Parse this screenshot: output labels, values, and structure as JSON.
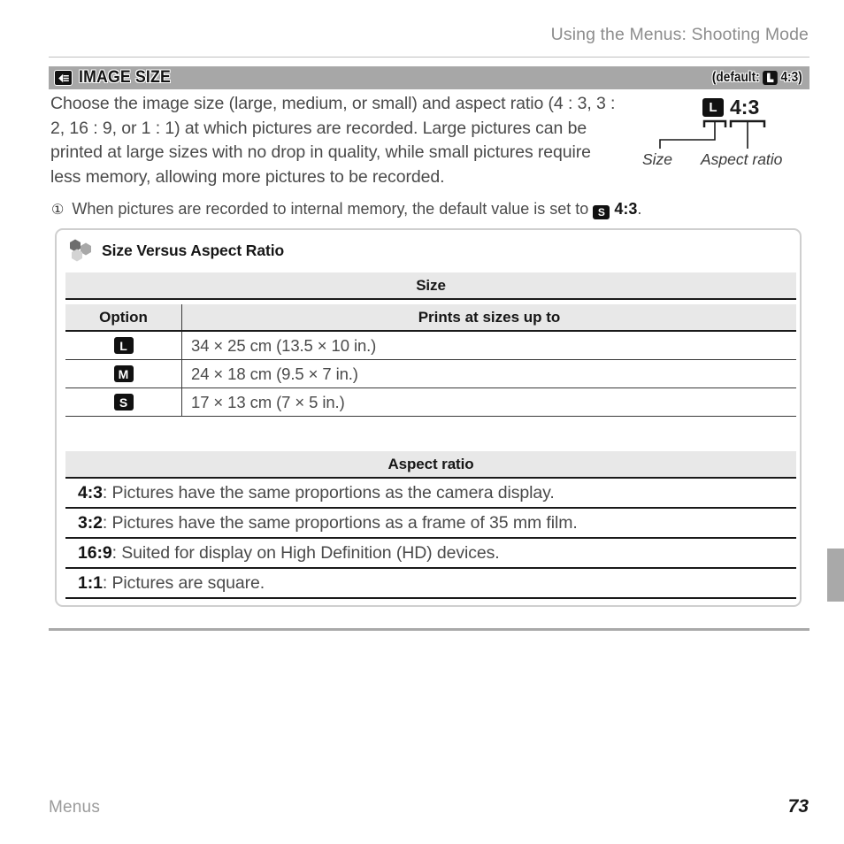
{
  "running_head": "Using the Menus: Shooting Mode",
  "section": {
    "icon": "image-size-menu-icon",
    "title": "IMAGE SIZE",
    "default_prefix": "(default:",
    "default_badge": "L",
    "default_ratio": "4:3)",
    "body": "Choose the image size (large, medium, or small) and aspect ratio (4 : 3, 3 : 2, 16 : 9, or 1 : 1) at which pictures are recorded.  Large pictures can be printed at large sizes with no drop in quality, while small pictures require less memory, allowing more pictures to be recorded."
  },
  "diagram": {
    "badge": "L",
    "ratio": "4:3",
    "label_size": "Size",
    "label_aspect": "Aspect ratio"
  },
  "note": {
    "icon": "caution-circled-one-icon",
    "text_before": "When pictures are recorded to internal memory, the default value is set to",
    "badge": "S",
    "ratio": "4:3",
    "text_after": "."
  },
  "tip": {
    "icon": "hexagons-tip-icon",
    "title": "Size Versus Aspect Ratio",
    "size_table": {
      "band": "Size",
      "columns": [
        "Option",
        "Prints at sizes up to"
      ],
      "rows": [
        {
          "option": "L",
          "prints": "34 × 25 cm (13.5 × 10 in.)"
        },
        {
          "option": "M",
          "prints": "24 × 18 cm (9.5 × 7 in.)"
        },
        {
          "option": "S",
          "prints": "17 × 13 cm (7 × 5 in.)"
        }
      ]
    },
    "aspect_table": {
      "band": "Aspect ratio",
      "rows": [
        {
          "ratio": "4:3",
          "desc": ": Pictures have the same proportions as the camera display."
        },
        {
          "ratio": "3:2",
          "desc": ": Pictures have the same proportions as a frame of 35 mm film."
        },
        {
          "ratio": "16:9",
          "desc": ": Suited for display on High Definition (HD) devices."
        },
        {
          "ratio": "1:1",
          "desc": ": Pictures are square."
        }
      ]
    }
  },
  "footer": {
    "chapter": "Menus",
    "page": "73"
  },
  "colors": {
    "title_bar": "#a7a7a7",
    "band": "#e8e8e8",
    "rule": "#1a1a1a",
    "muted_text": "#8d8d8d",
    "box_border": "#cfcfcf"
  }
}
